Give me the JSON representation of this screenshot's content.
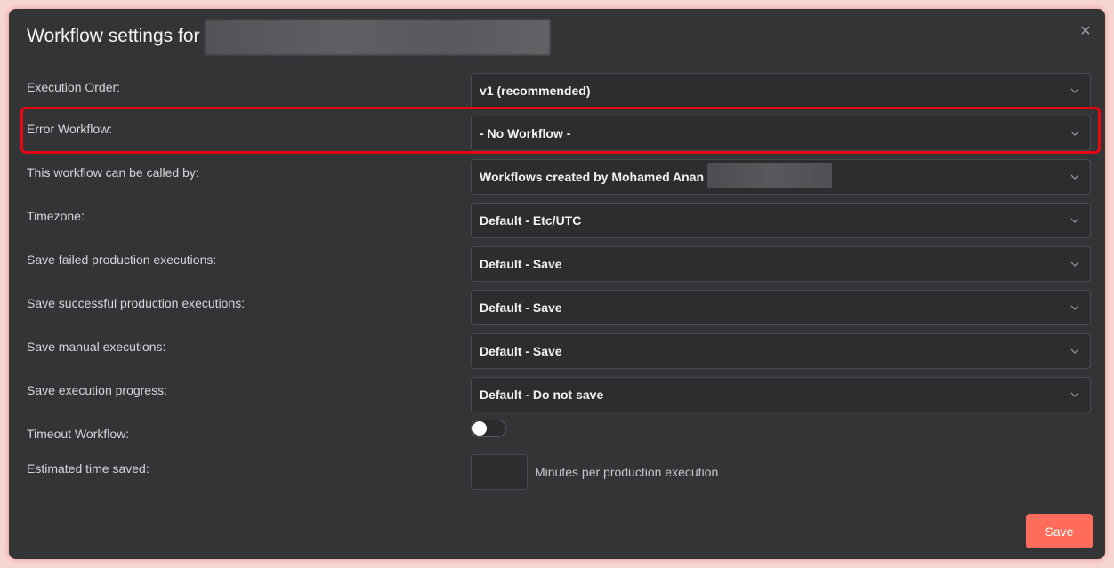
{
  "dialog": {
    "title": "Workflow settings for",
    "close_icon": "close-icon"
  },
  "settings": [
    {
      "label": "Execution Order:",
      "value": "v1 (recommended)"
    },
    {
      "label": "Error Workflow:",
      "value": "- No Workflow -"
    },
    {
      "label": "This workflow can be called by:",
      "value": "Workflows created by Mohamed Anan"
    },
    {
      "label": "Timezone:",
      "value": "Default - Etc/UTC"
    },
    {
      "label": "Save failed production executions:",
      "value": "Default - Save"
    },
    {
      "label": "Save successful production executions:",
      "value": "Default - Save"
    },
    {
      "label": "Save manual executions:",
      "value": "Default - Save"
    },
    {
      "label": "Save execution progress:",
      "value": "Default - Do not save"
    }
  ],
  "timeout": {
    "label": "Timeout Workflow:",
    "enabled": false
  },
  "time_saved": {
    "label": "Estimated time saved:",
    "value": "",
    "suffix": "Minutes per production execution"
  },
  "footer": {
    "save_label": "Save"
  },
  "colors": {
    "accent": "#ff6d5a",
    "highlight": "#e30613",
    "background": "#333436"
  }
}
